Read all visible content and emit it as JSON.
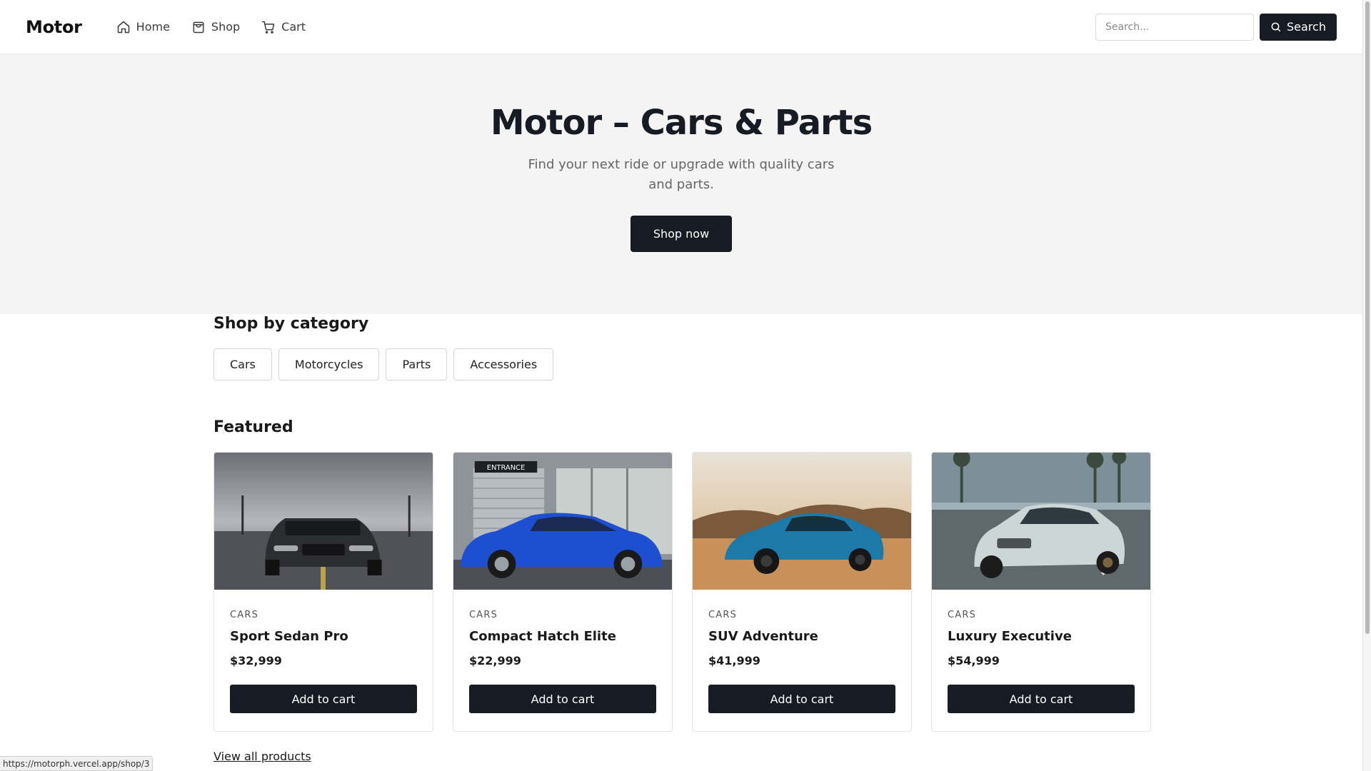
{
  "header": {
    "logo": "Motor",
    "nav": [
      {
        "label": "Home",
        "icon": "home-icon"
      },
      {
        "label": "Shop",
        "icon": "shopping-bag-icon"
      },
      {
        "label": "Cart",
        "icon": "cart-icon"
      }
    ],
    "search_placeholder": "Search...",
    "search_button": "Search"
  },
  "hero": {
    "title": "Motor – Cars & Parts",
    "subtitle": "Find your next ride or upgrade with quality cars and parts.",
    "cta": "Shop now"
  },
  "categories": {
    "title": "Shop by category",
    "items": [
      "Cars",
      "Motorcycles",
      "Parts",
      "Accessories"
    ]
  },
  "featured": {
    "title": "Featured",
    "products": [
      {
        "category": "CARS",
        "name": "Sport Sedan Pro",
        "price": "$32,999",
        "button": "Add to cart",
        "image": "black-muscle-car-photo",
        "car_color": "#2b2d31",
        "bg_color": "#8b8d92"
      },
      {
        "category": "CARS",
        "name": "Compact Hatch Elite",
        "price": "$22,999",
        "button": "Add to cart",
        "image": "blue-coupe-photo",
        "car_color": "#1f4fd1",
        "bg_color": "#8f949b",
        "sign": "ENTRANCE"
      },
      {
        "category": "CARS",
        "name": "SUV Adventure",
        "price": "$41,999",
        "button": "Add to cart",
        "image": "teal-sports-car-desert-photo",
        "car_color": "#1c79a8",
        "bg_color": "#c8915a"
      },
      {
        "category": "CARS",
        "name": "Luxury Executive",
        "price": "$54,999",
        "button": "Add to cart",
        "image": "white-sedan-street-photo",
        "car_color": "#cdd6d6",
        "bg_color": "#6d7678"
      }
    ],
    "view_all": "View all products"
  },
  "status_bar": {
    "url": "https://motorph.vercel.app/shop/3"
  },
  "colors": {
    "primary": "#171b24",
    "hero_bg": "#f4f4f4",
    "text": "#1a1a1a",
    "muted": "#666666"
  }
}
